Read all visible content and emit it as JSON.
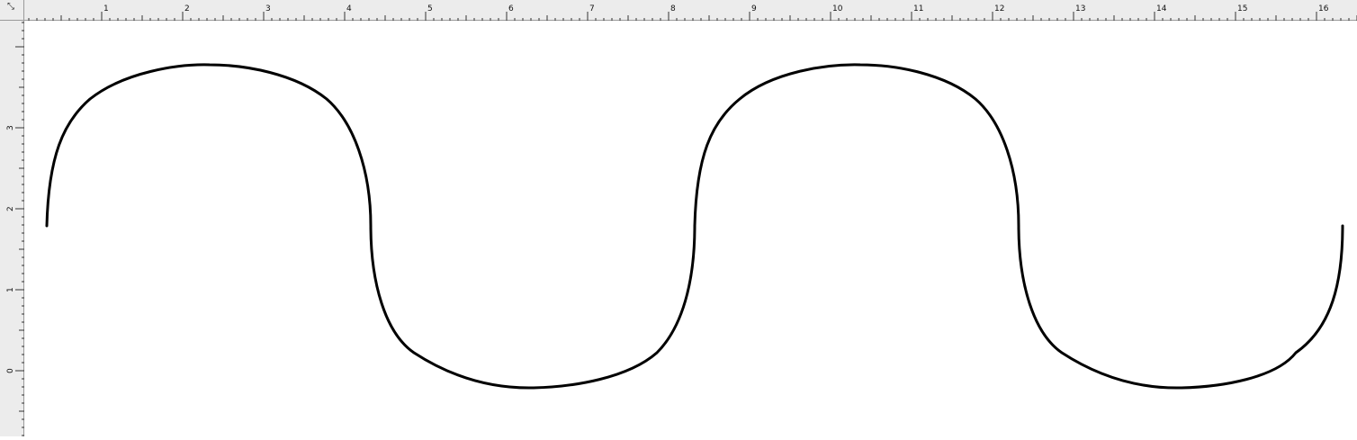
{
  "rulers": {
    "corner_icon": "ruler-origin-icon",
    "horizontal": {
      "labels": [
        "1",
        "2",
        "3",
        "4",
        "5",
        "6",
        "7",
        "8",
        "9",
        "10",
        "11",
        "12",
        "13",
        "14",
        "15",
        "16"
      ]
    },
    "vertical": {
      "labels": [
        "3",
        "2",
        "1",
        "0"
      ]
    }
  },
  "colors": {
    "ruler_bg": "#ececec",
    "stroke": "#000000",
    "canvas_bg": "#ffffff"
  }
}
